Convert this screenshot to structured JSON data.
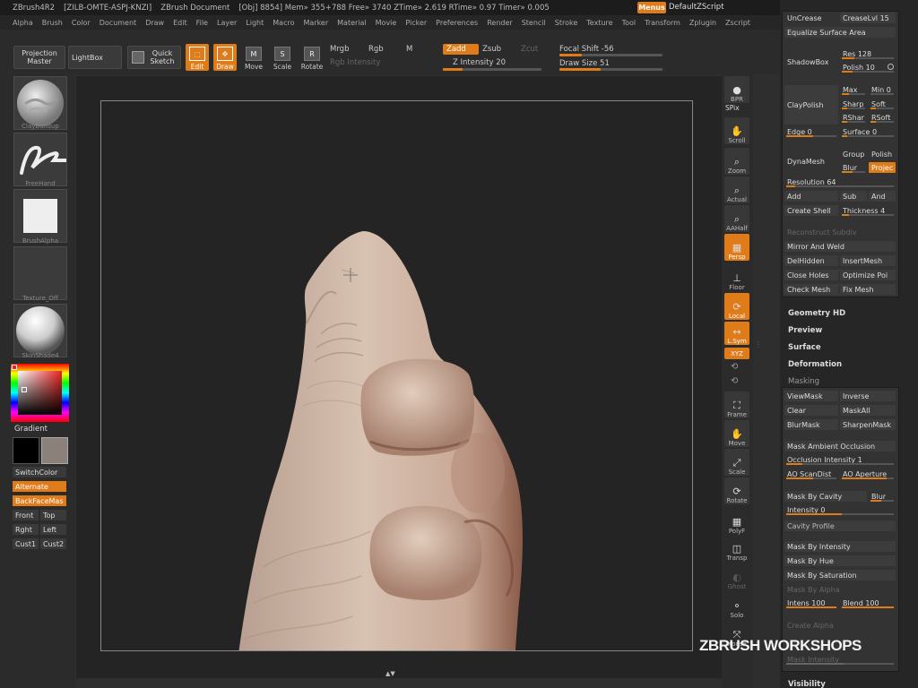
{
  "titlebar": {
    "app": "ZBrush4R2",
    "serial": "[ZILB-OMTE-ASPJ-KNZI]",
    "document": "ZBrush Document",
    "stats": "[Obj] 8854] Mem» 355+788  Free» 3740  ZTime» 2.619  RTime» 0.97  Timer» 0.005",
    "menus": "Menus",
    "script": "DefaultZScript"
  },
  "menubar": [
    "Alpha",
    "Brush",
    "Color",
    "Document",
    "Draw",
    "Edit",
    "File",
    "Layer",
    "Light",
    "Macro",
    "Marker",
    "Material",
    "Movie",
    "Picker",
    "Preferences",
    "Render",
    "Stencil",
    "Stroke",
    "Texture",
    "Tool",
    "Transform",
    "Zplugin",
    "Zscript"
  ],
  "toolbar": {
    "projection_master": "Projection Master",
    "lightbox": "LightBox",
    "quick_sketch": "Quick Sketch",
    "edit": "Edit",
    "draw": "Draw",
    "move": "Move",
    "scale": "Scale",
    "rotate": "Rotate",
    "mrgb": "Mrgb",
    "rgb": "Rgb",
    "m": "M",
    "rgb_intensity": "Rgb Intensity",
    "zadd": "Zadd",
    "zsub": "Zsub",
    "zcut": "Zcut",
    "z_intensity": "Z Intensity 20",
    "focal_shift": "Focal Shift -56",
    "draw_size": "Draw Size 51",
    "z_intensity_value": 20,
    "focal_shift_value": -56,
    "draw_size_value": 51
  },
  "leftshelf": {
    "brush_label": "ClayBuildup",
    "stroke_label": "FreeHand",
    "alpha_label": "BrushAlpha",
    "texture_label": "Texture_Off",
    "material_label": "SkinShade4",
    "gradient": "Gradient",
    "switchcolor": "SwitchColor",
    "alternate": "Alternate",
    "backfacemask": "BackFaceMas",
    "front": "Front",
    "top": "Top",
    "right": "Rght",
    "left": "Left",
    "cust1": "Cust1",
    "cust2": "Cust2"
  },
  "rightshelf": {
    "bpr": "BPR",
    "spix": "SPix",
    "scroll": "Scroll",
    "zoom": "Zoom",
    "actual": "Actual",
    "aahalf": "AAHalf",
    "persp": "Persp",
    "floor": "Floor",
    "local": "Local",
    "lsym": "L.Sym",
    "xyz": "XYZ",
    "frame": "Frame",
    "move": "Move",
    "scale": "Scale",
    "rotate": "Rotate",
    "polyf": "PolyF",
    "transp": "Transp",
    "ghost": "Ghost",
    "solo": "Solo",
    "xpose": "Xpose"
  },
  "panel": {
    "unrease": "UnCrease",
    "creasepg": "CreaseLvl 15",
    "equalize": "Equalize Surface Area",
    "shadowbox": "ShadowBox",
    "res": "Res 128",
    "polish": "Polish 10",
    "claypolish": "ClayPolish",
    "max": "Max",
    "min": "Min 0",
    "sharp": "Sharp",
    "soft": "Soft",
    "rshar": "RShar",
    "rsoft": "RSoft",
    "edge": "Edge 0",
    "surface": "Surface 0",
    "dynamesh": "DynaMesh",
    "group": "Group",
    "polish2": "Polish",
    "blur": "Blur",
    "project": "Projec",
    "resolution": "Resolution 64",
    "add": "Add",
    "sub": "Sub",
    "and": "And",
    "createshell": "Create Shell",
    "thickness": "Thickness 4",
    "reconstruct": "Reconstruct Subdiv",
    "mirrorweld": "Mirror And Weld",
    "delhidden": "DelHidden",
    "insertmesh": "InsertMesh",
    "closeholes": "Close Holes",
    "optimize": "Optimize Poi",
    "checkmesh": "Check Mesh",
    "fixmesh": "Fix Mesh",
    "geometryhd": "Geometry HD",
    "preview": "Preview",
    "surface_head": "Surface",
    "deformation": "Deformation",
    "masking": "Masking",
    "viewmask": "ViewMask",
    "inverse": "Inverse",
    "clear": "Clear",
    "maskall": "MaskAll",
    "blurmask": "BlurMask",
    "sharpenmask": "SharpenMask",
    "maskao": "Mask Ambient Occlusion",
    "occlusion": "Occlusion Intensity 1",
    "aoscandist": "AO ScanDist",
    "aoaperture": "AO Aperture",
    "maskcavity": "Mask By Cavity",
    "blur2": "Blur",
    "intensity": "Intensity 0",
    "cavityprofile": "Cavity Profile",
    "maskintensity": "Mask By Intensity",
    "maskhue": "Mask By Hue",
    "masksat": "Mask By Saturation",
    "maskalpha": "Mask By Alpha",
    "intens": "Intens 100",
    "blend": "Blend 100",
    "createalpha": "Create Alpha",
    "maskintensity2": "Mask Intensity",
    "visibility": "Visibility"
  },
  "watermark": "ZBRUSH WORKSHOPS",
  "colors": {
    "accent": "#e07b1a",
    "secondary_color": "#8a817a"
  }
}
